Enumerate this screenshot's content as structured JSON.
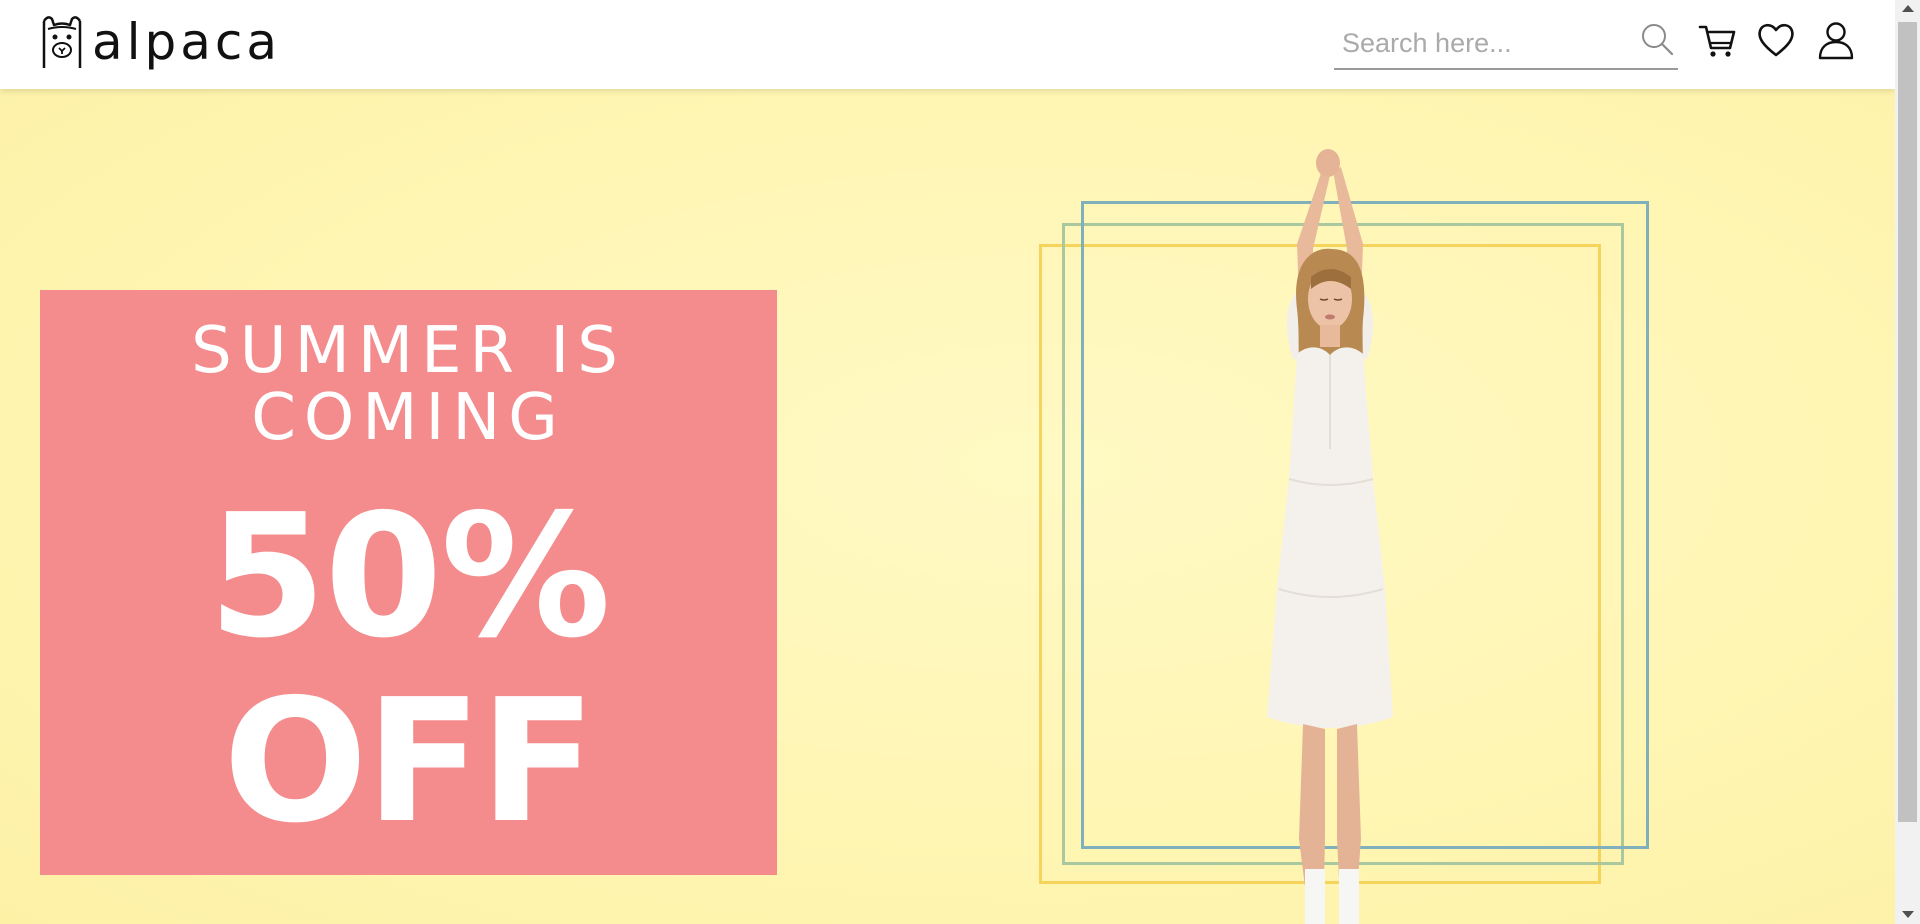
{
  "brand": {
    "name": "alpaca"
  },
  "header": {
    "search": {
      "placeholder": "Search here..."
    },
    "icons": [
      "search-icon",
      "cart-icon",
      "heart-icon",
      "user-icon"
    ]
  },
  "hero": {
    "headline": "SUMMER IS\nCOMING",
    "discount": "50%\nOFF",
    "colors": {
      "background": "#fff6b4",
      "promo_box": "#f48b8c",
      "frame_yellow": "#f6d35a",
      "frame_green": "#a9c8a0",
      "frame_blue": "#7fb0bb"
    }
  }
}
